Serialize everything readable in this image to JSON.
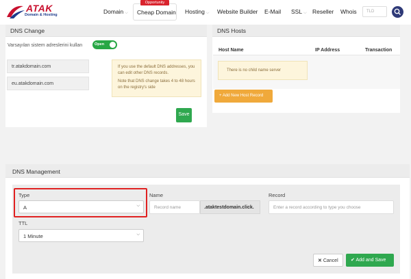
{
  "brand": {
    "name": "ATAK",
    "tagline": "Domain & Hosting",
    "accent": "#c8102e",
    "secondary": "#1d3b8b"
  },
  "nav": {
    "domain": "Domain",
    "cheap_domain": "Cheap Domain",
    "opportunity_badge": "Opportunity",
    "hosting": "Hosting",
    "website_builder": "Website Builder",
    "email": "E-Mail",
    "ssl": "SSL",
    "reseller": "Reseller",
    "whois": "Whois",
    "tld_placeholder": "TLD"
  },
  "dns_change": {
    "title": "DNS Change",
    "default_label": "Varsayılan sistem adreslerini kullan",
    "toggle_label": "Open",
    "nameservers": [
      "tr.atakdomain.com",
      "eu.atakdomain.com"
    ],
    "note_1": "If you use the default DNS addresses, you can edit other DNS records.",
    "note_2": "Note that DNS change takes 4 to 48 hours on the registry's side",
    "save_label": "Save"
  },
  "dns_hosts": {
    "title": "DNS Hosts",
    "columns": [
      "Host Name",
      "IP Address",
      "Transaction"
    ],
    "empty_message": "There is no child name server",
    "add_button": "+ Add New Host Record"
  },
  "dns_management": {
    "title": "DNS Management",
    "type_label": "Type",
    "type_value": "A",
    "name_label": "Name",
    "name_placeholder": "Record name",
    "domain_suffix": ".ataktestdomain.click.",
    "record_label": "Record",
    "record_placeholder": "Enter a record according to type you choose",
    "ttl_label": "TTL",
    "ttl_value": "1 Minute",
    "cancel_label": "Cancel",
    "add_save_label": "Add and Save"
  },
  "colors": {
    "green": "#2fa84f",
    "orange": "#f0a93b",
    "highlight": "#e02020",
    "nav_dark": "#2f3a78"
  }
}
